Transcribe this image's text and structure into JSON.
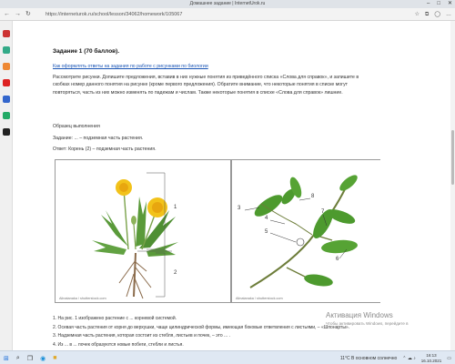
{
  "window": {
    "title": "Домашнее задание | InternetUrok.ru",
    "minimize": "–",
    "maximize": "□",
    "close": "✕"
  },
  "browser": {
    "back": "←",
    "forward": "→",
    "reload": "↻",
    "url": "https://interneturok.ru/school/lesson/34062/homework/105067",
    "favorite_icon": "star-icon",
    "menu_icon": "menu-icon"
  },
  "content": {
    "task_title": "Задание 1 (70 баллов).",
    "help_link": "Как оформлять ответы на задания по работе с рисунками по биологии",
    "paragraph": "Рассмотрите рисунки. Допишите предложения, вставив в них нужные понятия из приведённого списка «Слова для справок», и запишите в скобках номер данного понятия на рисунке (кроме первого предложения). Обратите внимание, что некоторые понятия в списке могут повторяться, часть из них можно изменять по падежам и числам. Также некоторые понятия в списке «Слова для справок» лишние.",
    "sample_heading": "Образец выполнения",
    "sample_task": "Задание: ... – подземная часть растения.",
    "sample_answer": "Ответ: Корень (2) – подземная часть растения.",
    "figure1": {
      "credit": "Alinatanaka / shutterstock.com",
      "label1": "1",
      "label2": "2"
    },
    "figure2": {
      "credit": "Alinatanaka / shutterstock.com",
      "labels": [
        "3",
        "4",
        "5",
        "6",
        "7",
        "8"
      ]
    },
    "questions": [
      "1. На рис. 1 изображено растение с ... корневой системой.",
      "2. Осевая часть растения от корня до верхушки, чаще цилиндрической формы, имеющая боковые ответвления с листьями, – «Шпонарты».",
      "3. Надземная часть растения, которая состоит из стебля, листьев и почек, – это ... .",
      "4. Из ... в ... почек образуются новые побеги, стебли и листья."
    ]
  },
  "activation": {
    "title": "Активация Windows",
    "subtitle": "Чтобы активировать Windows, перейдите в"
  },
  "taskbar": {
    "weather": "11°C  В основном солнечно",
    "time": "16:13",
    "date": "16.10.2021",
    "start_icon": "windows-start-icon",
    "search_icon": "search-icon"
  },
  "colors": {
    "link": "#1a55b5",
    "titlebar": "#dfe3e8",
    "taskbar": "#dfe8f3"
  }
}
